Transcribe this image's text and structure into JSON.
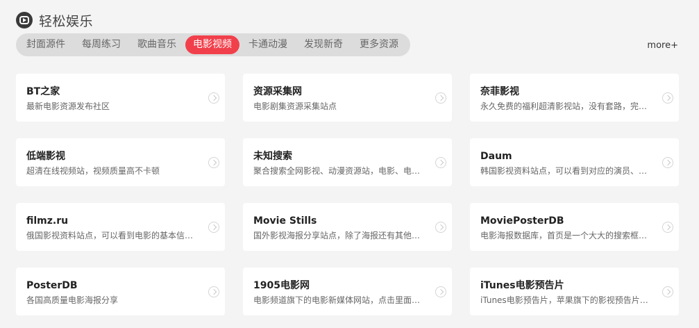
{
  "section": {
    "title": "轻松娱乐",
    "icon": "play-icon"
  },
  "tabs": [
    {
      "label": "封面源件",
      "active": false
    },
    {
      "label": "每周练习",
      "active": false
    },
    {
      "label": "歌曲音乐",
      "active": false
    },
    {
      "label": "电影视频",
      "active": true
    },
    {
      "label": "卡通动漫",
      "active": false
    },
    {
      "label": "发现新奇",
      "active": false
    },
    {
      "label": "更多资源",
      "active": false
    }
  ],
  "more_label": "more+",
  "cards": [
    {
      "title": "BT之家",
      "desc": "最新电影资源发布社区"
    },
    {
      "title": "资源采集网",
      "desc": "电影剧集资源采集站点"
    },
    {
      "title": "奈菲影视",
      "desc": "永久免费的福利超清影视站，没有套路，完全免费"
    },
    {
      "title": "低端影视",
      "desc": "超清在线视频站，视频质量高不卡顿"
    },
    {
      "title": "未知搜索",
      "desc": "聚合搜索全网影视、动漫资源站，电影、电视剧、动漫"
    },
    {
      "title": "Daum",
      "desc": "韩国影视资料站点，可以看到对应的演员、影视简介"
    },
    {
      "title": "filmz.ru",
      "desc": "俄国影视资料站点，可以看到电影的基本信息与剧照"
    },
    {
      "title": "Movie Stills",
      "desc": "国外影视海报分享站点，除了海报还有其他内容可以看"
    },
    {
      "title": "MoviePosterDB",
      "desc": "电影海报数据库，首页是一个大大的搜索框，据说收录"
    },
    {
      "title": "PosterDB",
      "desc": "各国高质量电影海报分享"
    },
    {
      "title": "1905电影网",
      "desc": "电影频道旗下的电影新媒体网站，点击里面的电影可以"
    },
    {
      "title": "iTunes电影预告片",
      "desc": "iTunes电影预告片，苹果旗下的影视预告片平台"
    }
  ],
  "colors": {
    "accent": "#f1404b",
    "tab_bar": "#dcdcdc",
    "page_bg": "#f4f4f4"
  }
}
